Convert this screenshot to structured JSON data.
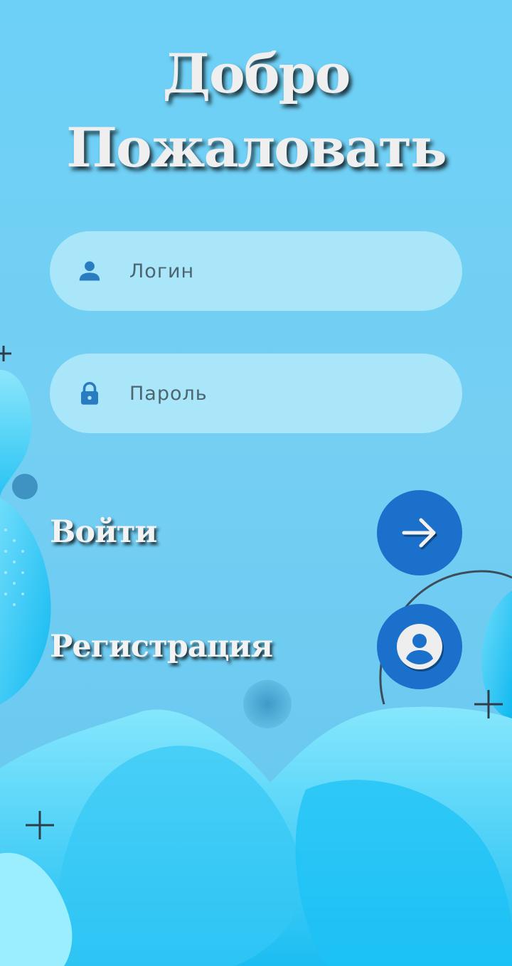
{
  "title": {
    "line1": "Добро",
    "line2": "Пожаловать"
  },
  "login_field": {
    "placeholder": "Логин",
    "icon": "person-icon"
  },
  "password_field": {
    "placeholder": "Пароль",
    "icon": "lock-icon"
  },
  "actions": {
    "login_label": "Войти",
    "login_icon": "arrow-right-icon",
    "register_label": "Регистрация",
    "register_icon": "account-circle-icon"
  },
  "colors": {
    "background": "#6dd0f6",
    "field": "#aae6fa",
    "button": "#1b70cc",
    "icon": "#2a7cc0"
  }
}
